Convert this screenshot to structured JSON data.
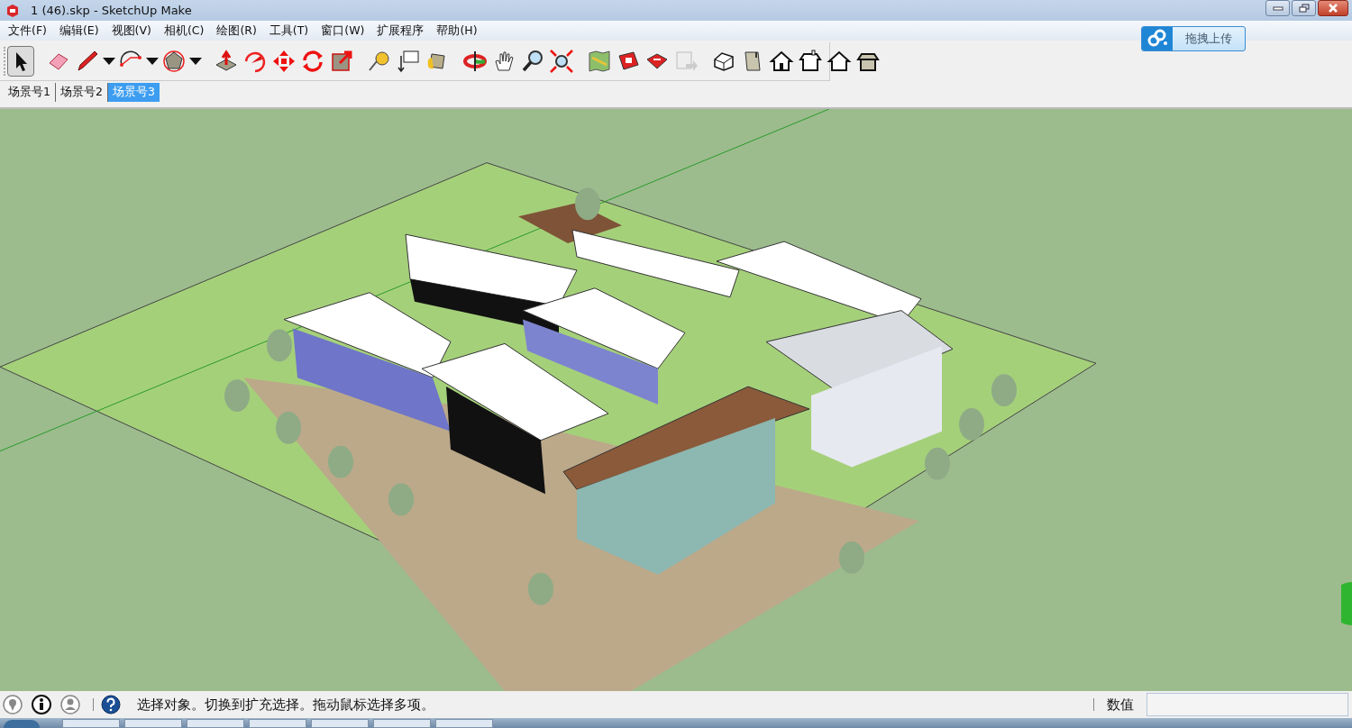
{
  "window": {
    "title": "1 (46).skp - SketchUp Make"
  },
  "menu": [
    "文件(F)",
    "编辑(E)",
    "视图(V)",
    "相机(C)",
    "绘图(R)",
    "工具(T)",
    "窗口(W)",
    "扩展程序",
    "帮助(H)"
  ],
  "upload_button": {
    "label": "拖拽上传"
  },
  "toolbar": [
    {
      "kind": "select",
      "selected": true
    },
    {
      "kind": "separator"
    },
    {
      "kind": "eraser",
      "selected": false
    },
    {
      "kind": "pencil",
      "selected": false
    },
    {
      "kind": "dropdown"
    },
    {
      "kind": "arc",
      "selected": false
    },
    {
      "kind": "dropdown"
    },
    {
      "kind": "polygon",
      "selected": false
    },
    {
      "kind": "dropdown"
    },
    {
      "kind": "separator"
    },
    {
      "kind": "pushpull",
      "selected": false
    },
    {
      "kind": "followme",
      "selected": false
    },
    {
      "kind": "move",
      "selected": false
    },
    {
      "kind": "rotate",
      "selected": false
    },
    {
      "kind": "scale",
      "selected": false
    },
    {
      "kind": "separator"
    },
    {
      "kind": "tape",
      "selected": false
    },
    {
      "kind": "text",
      "selected": false
    },
    {
      "kind": "paint",
      "selected": false
    },
    {
      "kind": "separator"
    },
    {
      "kind": "orbit",
      "selected": false
    },
    {
      "kind": "pan",
      "selected": false
    },
    {
      "kind": "zoom",
      "selected": false
    },
    {
      "kind": "zoomextents",
      "selected": false
    },
    {
      "kind": "separator"
    },
    {
      "kind": "map",
      "selected": false
    },
    {
      "kind": "warehouse",
      "selected": false
    },
    {
      "kind": "share",
      "selected": false
    },
    {
      "kind": "sendlayout",
      "selected": false
    },
    {
      "kind": "separator"
    },
    {
      "kind": "iso",
      "selected": false
    },
    {
      "kind": "box",
      "selected": false
    },
    {
      "kind": "front",
      "selected": false
    },
    {
      "kind": "top",
      "selected": false
    },
    {
      "kind": "side",
      "selected": false
    },
    {
      "kind": "back",
      "selected": false
    }
  ],
  "scenes": [
    {
      "label": "场景号1",
      "selected": false
    },
    {
      "label": "场景号2",
      "selected": false
    },
    {
      "label": "场景号3",
      "selected": true
    }
  ],
  "status_bar": {
    "hint": "选择对象。切换到扩充选择。拖动鼠标选择多项。",
    "measurements_label": "数值"
  }
}
